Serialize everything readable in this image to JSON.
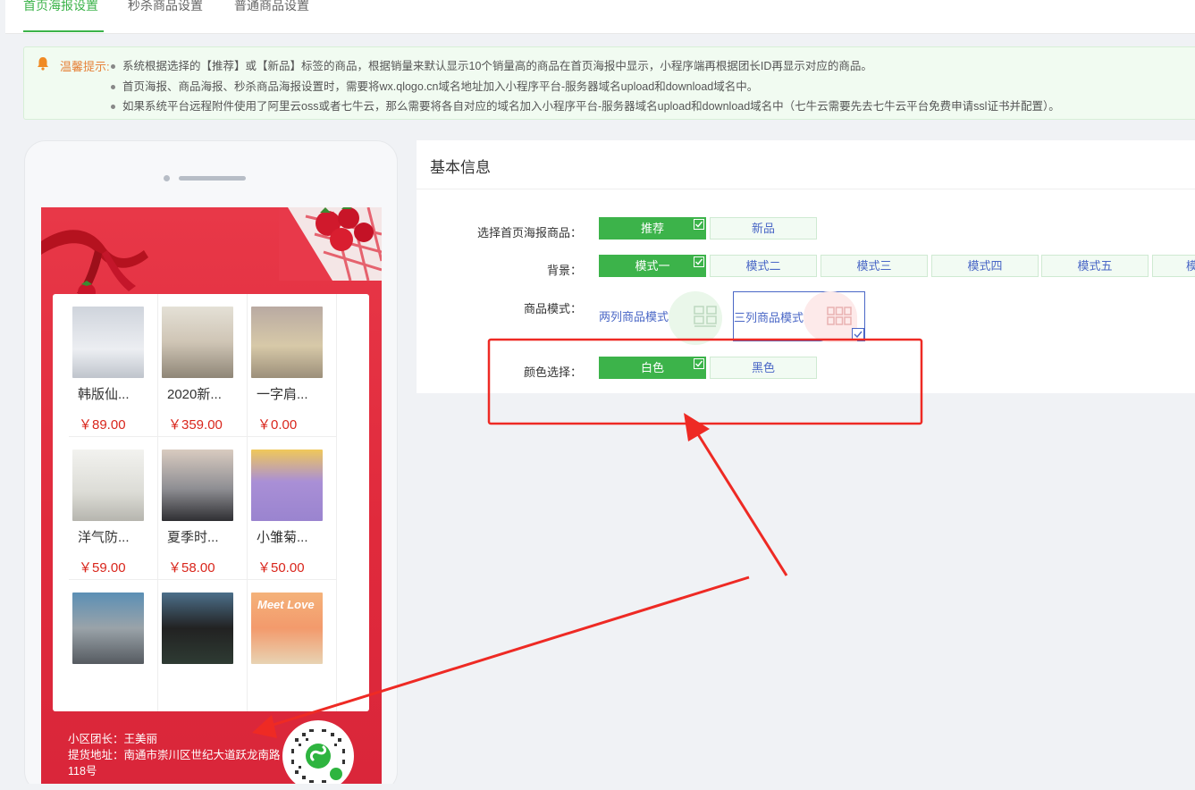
{
  "tabs": [
    {
      "label": "首页海报设置",
      "active": true
    },
    {
      "label": "秒杀商品设置",
      "active": false
    },
    {
      "label": "普通商品设置",
      "active": false
    }
  ],
  "tip": {
    "label": "温馨提示:",
    "items": [
      "系统根据选择的【推荐】或【新品】标签的商品，根据销量来默认显示10个销量高的商品在首页海报中显示，小程序端再根据团长ID再显示对应的商品。",
      "首页海报、商品海报、秒杀商品海报设置时，需要将wx.qlogo.cn域名地址加入小程序平台-服务器域名upload和download域名中。",
      "如果系统平台远程附件使用了阿里云oss或者七牛云，那么需要将各自对应的域名加入小程序平台-服务器域名upload和download域名中（七牛云需要先去七牛云平台免费申请ssl证书并配置）。"
    ]
  },
  "poster": {
    "products": [
      {
        "name": "韩版仙...",
        "price": "￥89.00"
      },
      {
        "name": "2020新...",
        "price": "￥359.00"
      },
      {
        "name": "一字肩...",
        "price": "￥0.00"
      },
      {
        "name": "洋气防...",
        "price": "￥59.00"
      },
      {
        "name": "夏季时...",
        "price": "￥58.00"
      },
      {
        "name": "小雏菊...",
        "price": "￥50.00"
      },
      {
        "name": "",
        "price": ""
      },
      {
        "name": "",
        "price": ""
      },
      {
        "name": "",
        "price": ""
      }
    ],
    "leader": "小区团长：王美丽",
    "address": "提货地址：南通市崇川区世纪大道跃龙南路118号",
    "thumb_text": "Meet Love"
  },
  "form": {
    "title": "基本信息",
    "goods_label": "选择首页海报商品：",
    "goods_options": [
      {
        "label": "推荐",
        "selected": true
      },
      {
        "label": "新品",
        "selected": false
      }
    ],
    "bg_label": "背景：",
    "bg_options": [
      {
        "label": "模式一",
        "selected": true
      },
      {
        "label": "模式二",
        "selected": false
      },
      {
        "label": "模式三",
        "selected": false
      },
      {
        "label": "模式四",
        "selected": false
      },
      {
        "label": "模式五",
        "selected": false
      },
      {
        "label": "模",
        "selected": false
      }
    ],
    "mode_label": "商品模式：",
    "mode_two": "两列商品模式",
    "mode_three": "三列商品模式",
    "color_label": "颜色选择：",
    "color_options": [
      {
        "label": "白色",
        "selected": true
      },
      {
        "label": "黑色",
        "selected": false
      }
    ]
  },
  "colors": {
    "primary": "#3cb34a",
    "link": "#4a67c6",
    "price": "#d9261c",
    "annotation": "#ee2a24",
    "poster": "#e2303f"
  }
}
